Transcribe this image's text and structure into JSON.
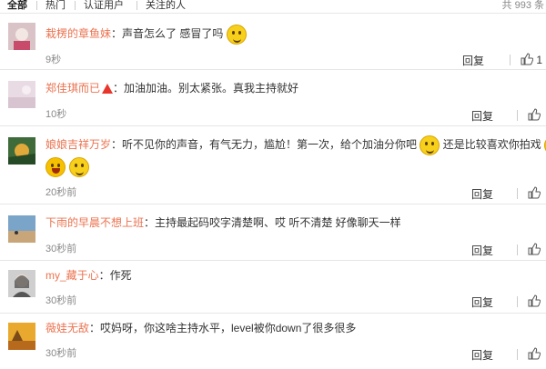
{
  "tabs": [
    {
      "label": "全部",
      "active": true
    },
    {
      "label": "热门",
      "active": false
    },
    {
      "label": "认证用户",
      "active": false
    },
    {
      "label": "关注的人",
      "active": false
    }
  ],
  "total_text": "共 993 条",
  "reply_label": "回复",
  "like_icon": "thumbs-up-icon",
  "colors": {
    "username": "#eb7350",
    "time": "#888888"
  },
  "comments": [
    {
      "user": "栽楞的章鱼妹",
      "text": "：声音怎么了 感冒了吗",
      "time": "9秒",
      "like_count": "1"
    },
    {
      "user": "郑佳琪而已",
      "text": "：加油加油。别太紧张。真我主持就好",
      "time": "10秒"
    },
    {
      "user": "娘娘吉祥万岁",
      "text": "：听不见你的声音，有气无力，尴尬！第一次，给个加油分你吧",
      "text2": "还是比较喜欢你拍戏",
      "time": "20秒前"
    },
    {
      "user": "下雨的早晨不想上班",
      "text": "：主持最起码咬字清楚啊、哎 听不清楚 好像聊天一样",
      "time": "30秒前"
    },
    {
      "user": "my_藏于心",
      "text": "：作死",
      "time": "30秒前"
    },
    {
      "user": "薇娃无敌",
      "text": "：哎妈呀，你这啥主持水平，level被你down了很多很多",
      "time": "30秒前"
    }
  ]
}
